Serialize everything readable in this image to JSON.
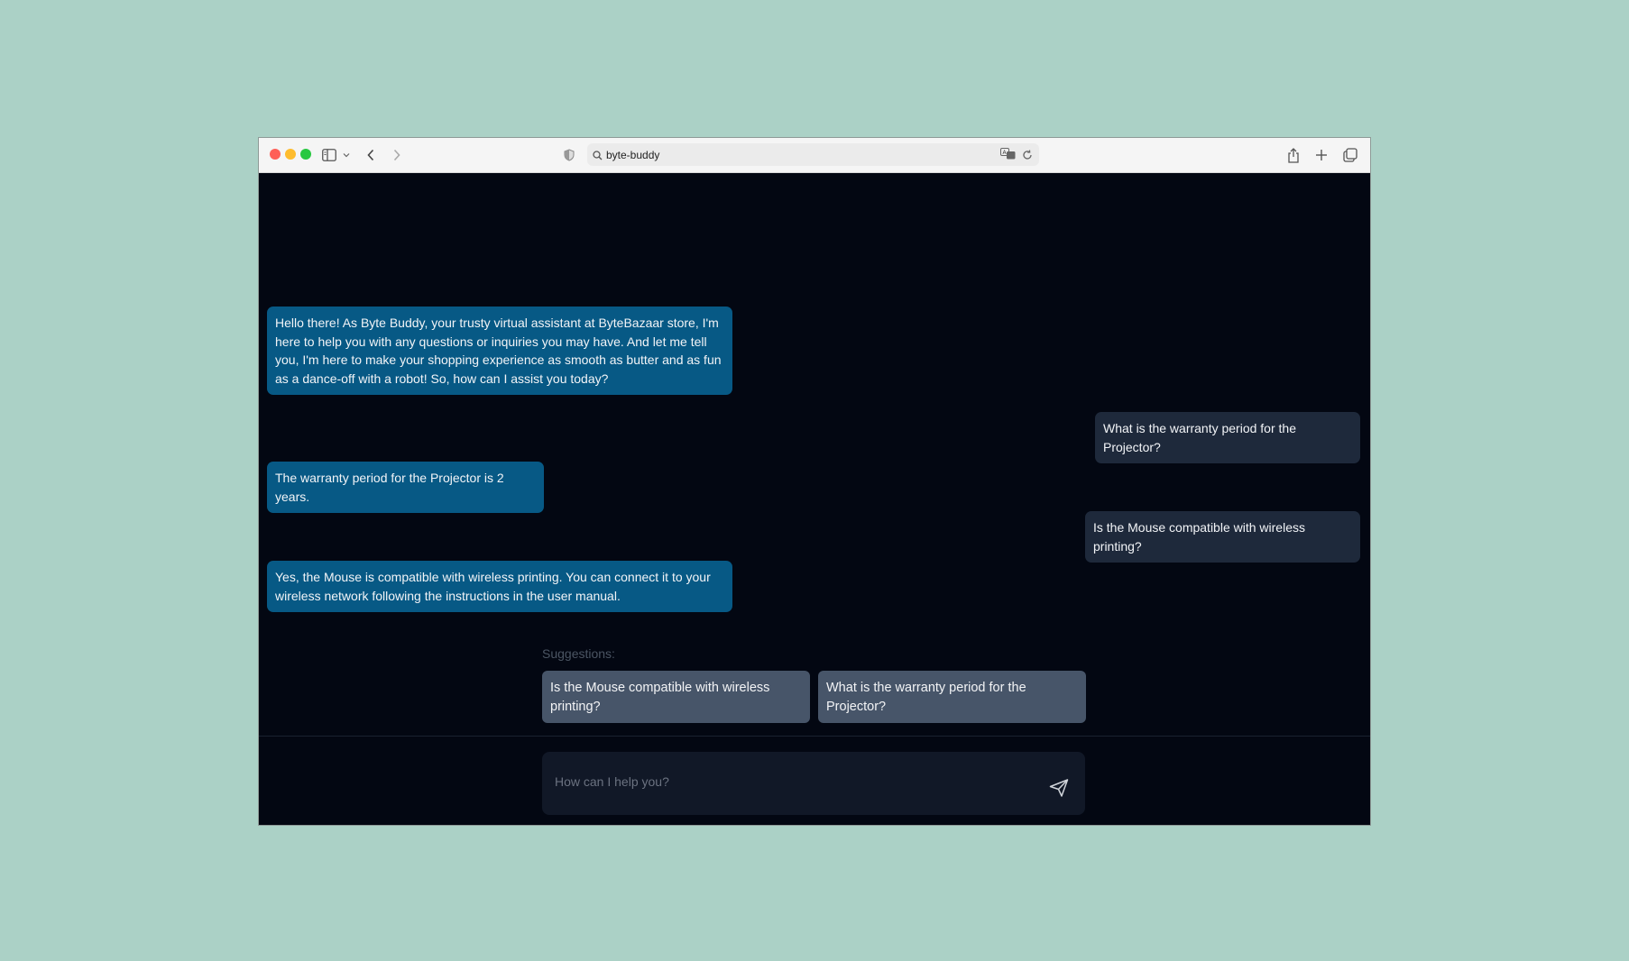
{
  "browser": {
    "url": "byte-buddy"
  },
  "chat": {
    "messages": [
      {
        "role": "assistant",
        "text": "Hello there! As Byte Buddy, your trusty virtual assistant at ByteBazaar store, I'm here to help you with any questions or inquiries you may have. And let me tell you, I'm here to make your shopping experience as smooth as butter and as fun as a dance-off with a robot! So, how can I assist you today?"
      },
      {
        "role": "user",
        "text": "What is the warranty period for the Projector?"
      },
      {
        "role": "assistant",
        "text": "The warranty period for the Projector is 2 years."
      },
      {
        "role": "user",
        "text": "Is the Mouse compatible with wireless printing?"
      },
      {
        "role": "assistant",
        "text": "Yes, the Mouse is compatible with wireless printing. You can connect it to your wireless network following the instructions in the user manual."
      }
    ]
  },
  "suggestions": {
    "label": "Suggestions:",
    "items": [
      "Is the Mouse compatible with wireless printing?",
      "What is the warranty period for the Projector?"
    ]
  },
  "composer": {
    "placeholder": "How can I help you?"
  },
  "colors": {
    "page_background": "#abd1c6",
    "app_background": "#030712",
    "assistant_bubble": "#075985",
    "user_bubble": "#1e293b",
    "suggestion_chip": "#475569"
  },
  "icons": [
    "sidebar-icon",
    "chevron-down-icon",
    "back-icon",
    "forward-icon",
    "shield-icon",
    "search-icon",
    "translate-icon",
    "reload-icon",
    "share-icon",
    "new-tab-icon",
    "tabs-overview-icon",
    "send-icon"
  ]
}
